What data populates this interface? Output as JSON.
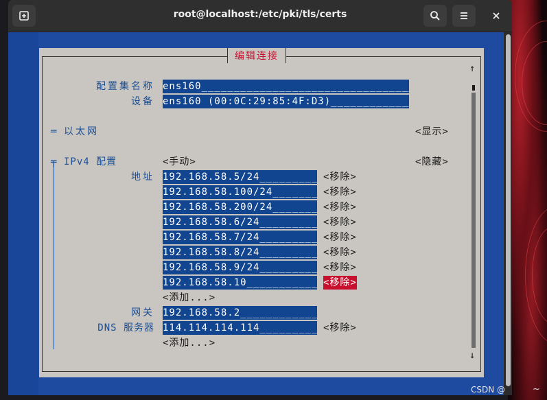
{
  "window": {
    "title": "root@localhost:/etc/pki/tls/certs",
    "icons": [
      "new-tab-icon",
      "search-icon",
      "hamburger-menu-icon",
      "close-icon"
    ]
  },
  "dialog": {
    "title": "编辑连接",
    "profile_name_label": "配置集名称",
    "profile_name_value": "ens160____________________________________",
    "device_label": "设备",
    "device_value": "ens160 (00:0C:29:85:4F:D3)______________",
    "ethernet": {
      "marker": "═",
      "label": "以太网",
      "toggle": "<显示>"
    },
    "ipv4": {
      "marker": "╤",
      "label": "IPv4 配置",
      "method": "<手动>",
      "toggle": "<隐藏>",
      "address_label": "地址",
      "addresses": [
        {
          "value": "192.168.58.5/24_________",
          "remove": "<移除>"
        },
        {
          "value": "192.168.58.100/24_______",
          "remove": "<移除>"
        },
        {
          "value": "192.168.58.200/24_______",
          "remove": "<移除>"
        },
        {
          "value": "192.168.58.6/24_________",
          "remove": "<移除>"
        },
        {
          "value": "192.168.58.7/24_________",
          "remove": "<移除>"
        },
        {
          "value": "192.168.58.8/24_________",
          "remove": "<移除>"
        },
        {
          "value": "192.168.58.9/24_________",
          "remove": "<移除>"
        },
        {
          "value": "192.168.58.10___________",
          "remove": "<移除>"
        }
      ],
      "add_address": "<添加...>",
      "gateway_label": "网关",
      "gateway_value": "192.168.58.2____________",
      "dns_label": "DNS 服务器",
      "dns": [
        {
          "value": "114.114.114.114_________",
          "remove": "<移除>"
        }
      ],
      "add_dns": "<添加...>"
    },
    "scroll_up": "↑",
    "scroll_down": "↓"
  },
  "watermark": "CSDN @",
  "tilde": "~",
  "colors": {
    "terminal_bg": "#1e4aa0",
    "dialog_bg": "#c9c6c2",
    "field_bg": "#12458f",
    "label_text": "#1d4f93",
    "title_red": "#c8102e",
    "focus_red": "#c8102e"
  }
}
